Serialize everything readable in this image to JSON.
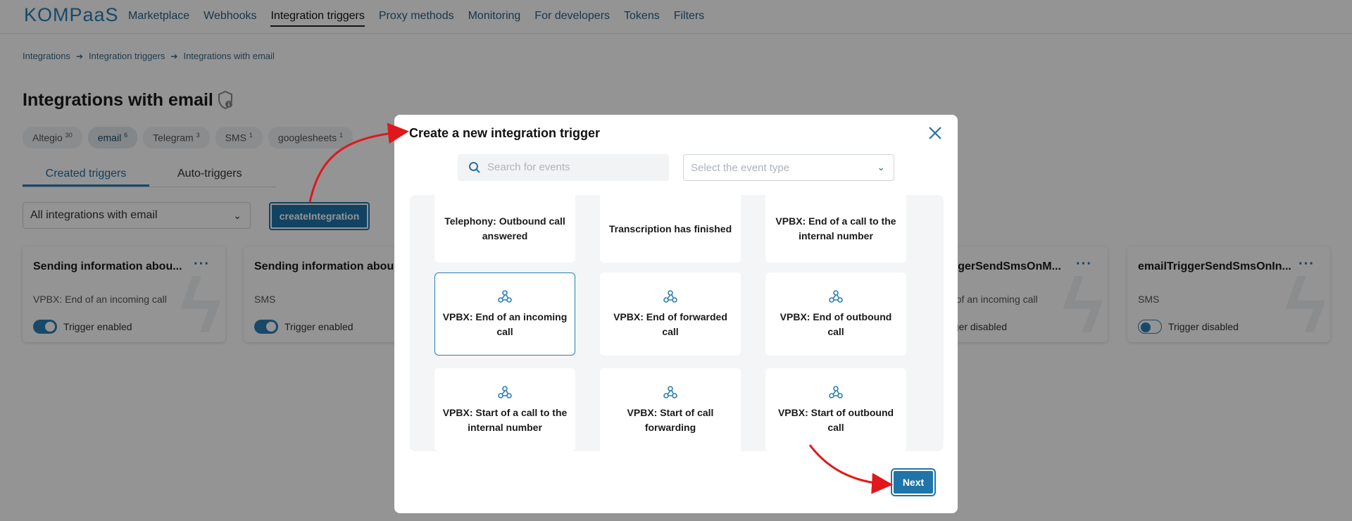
{
  "header": {
    "logo": "KOMPaaS",
    "nav": [
      "Marketplace",
      "Webhooks",
      "Integration triggers",
      "Proxy methods",
      "Monitoring",
      "For developers",
      "Tokens",
      "Filters"
    ],
    "active_nav": "Integration triggers"
  },
  "breadcrumbs": [
    "Integrations",
    "Integration triggers",
    "Integrations with email"
  ],
  "page_title": "Integrations with email",
  "chips": [
    {
      "label": "Altegio",
      "count": "30"
    },
    {
      "label": "email",
      "count": "6"
    },
    {
      "label": "Telegram",
      "count": "3"
    },
    {
      "label": "SMS",
      "count": "1"
    },
    {
      "label": "googlesheets",
      "count": "1"
    }
  ],
  "tabs": [
    "Created triggers",
    "Auto-triggers"
  ],
  "filter_select": "All integrations with email",
  "create_button": "createIntegration",
  "cards": [
    {
      "title": "Sending information abou...",
      "subtitle": "VPBX: End of an incoming call",
      "toggle_label": "Trigger enabled",
      "enabled": true
    },
    {
      "title": "Sending information abou",
      "subtitle": "SMS",
      "toggle_label": "Trigger enabled",
      "enabled": true
    },
    {
      "title": "iggerSendSmsOnM...",
      "subtitle": "d of an incoming call",
      "toggle_label": "gger disabled",
      "enabled": false
    },
    {
      "title": "emailTriggerSendSmsOnIn...",
      "subtitle": "SMS",
      "toggle_label": "Trigger disabled",
      "enabled": false
    }
  ],
  "modal": {
    "title": "Create a new integration trigger",
    "search_placeholder": "Search for events",
    "type_placeholder": "Select the event type",
    "events": [
      "Telephony: Outbound call answered",
      "Transcription has finished",
      "VPBX: End of a call to the internal number",
      "VPBX: End of an incoming call",
      "VPBX: End of forwarded call",
      "VPBX: End of outbound call",
      "VPBX: Start of a call to the internal number",
      "VPBX: Start of call forwarding",
      "VPBX: Start of outbound call"
    ],
    "next_button": "Next"
  },
  "colors": {
    "accent": "#1f74a9",
    "overlay": "rgba(0,0,0,0.42)",
    "annotation": "#e0181b"
  }
}
